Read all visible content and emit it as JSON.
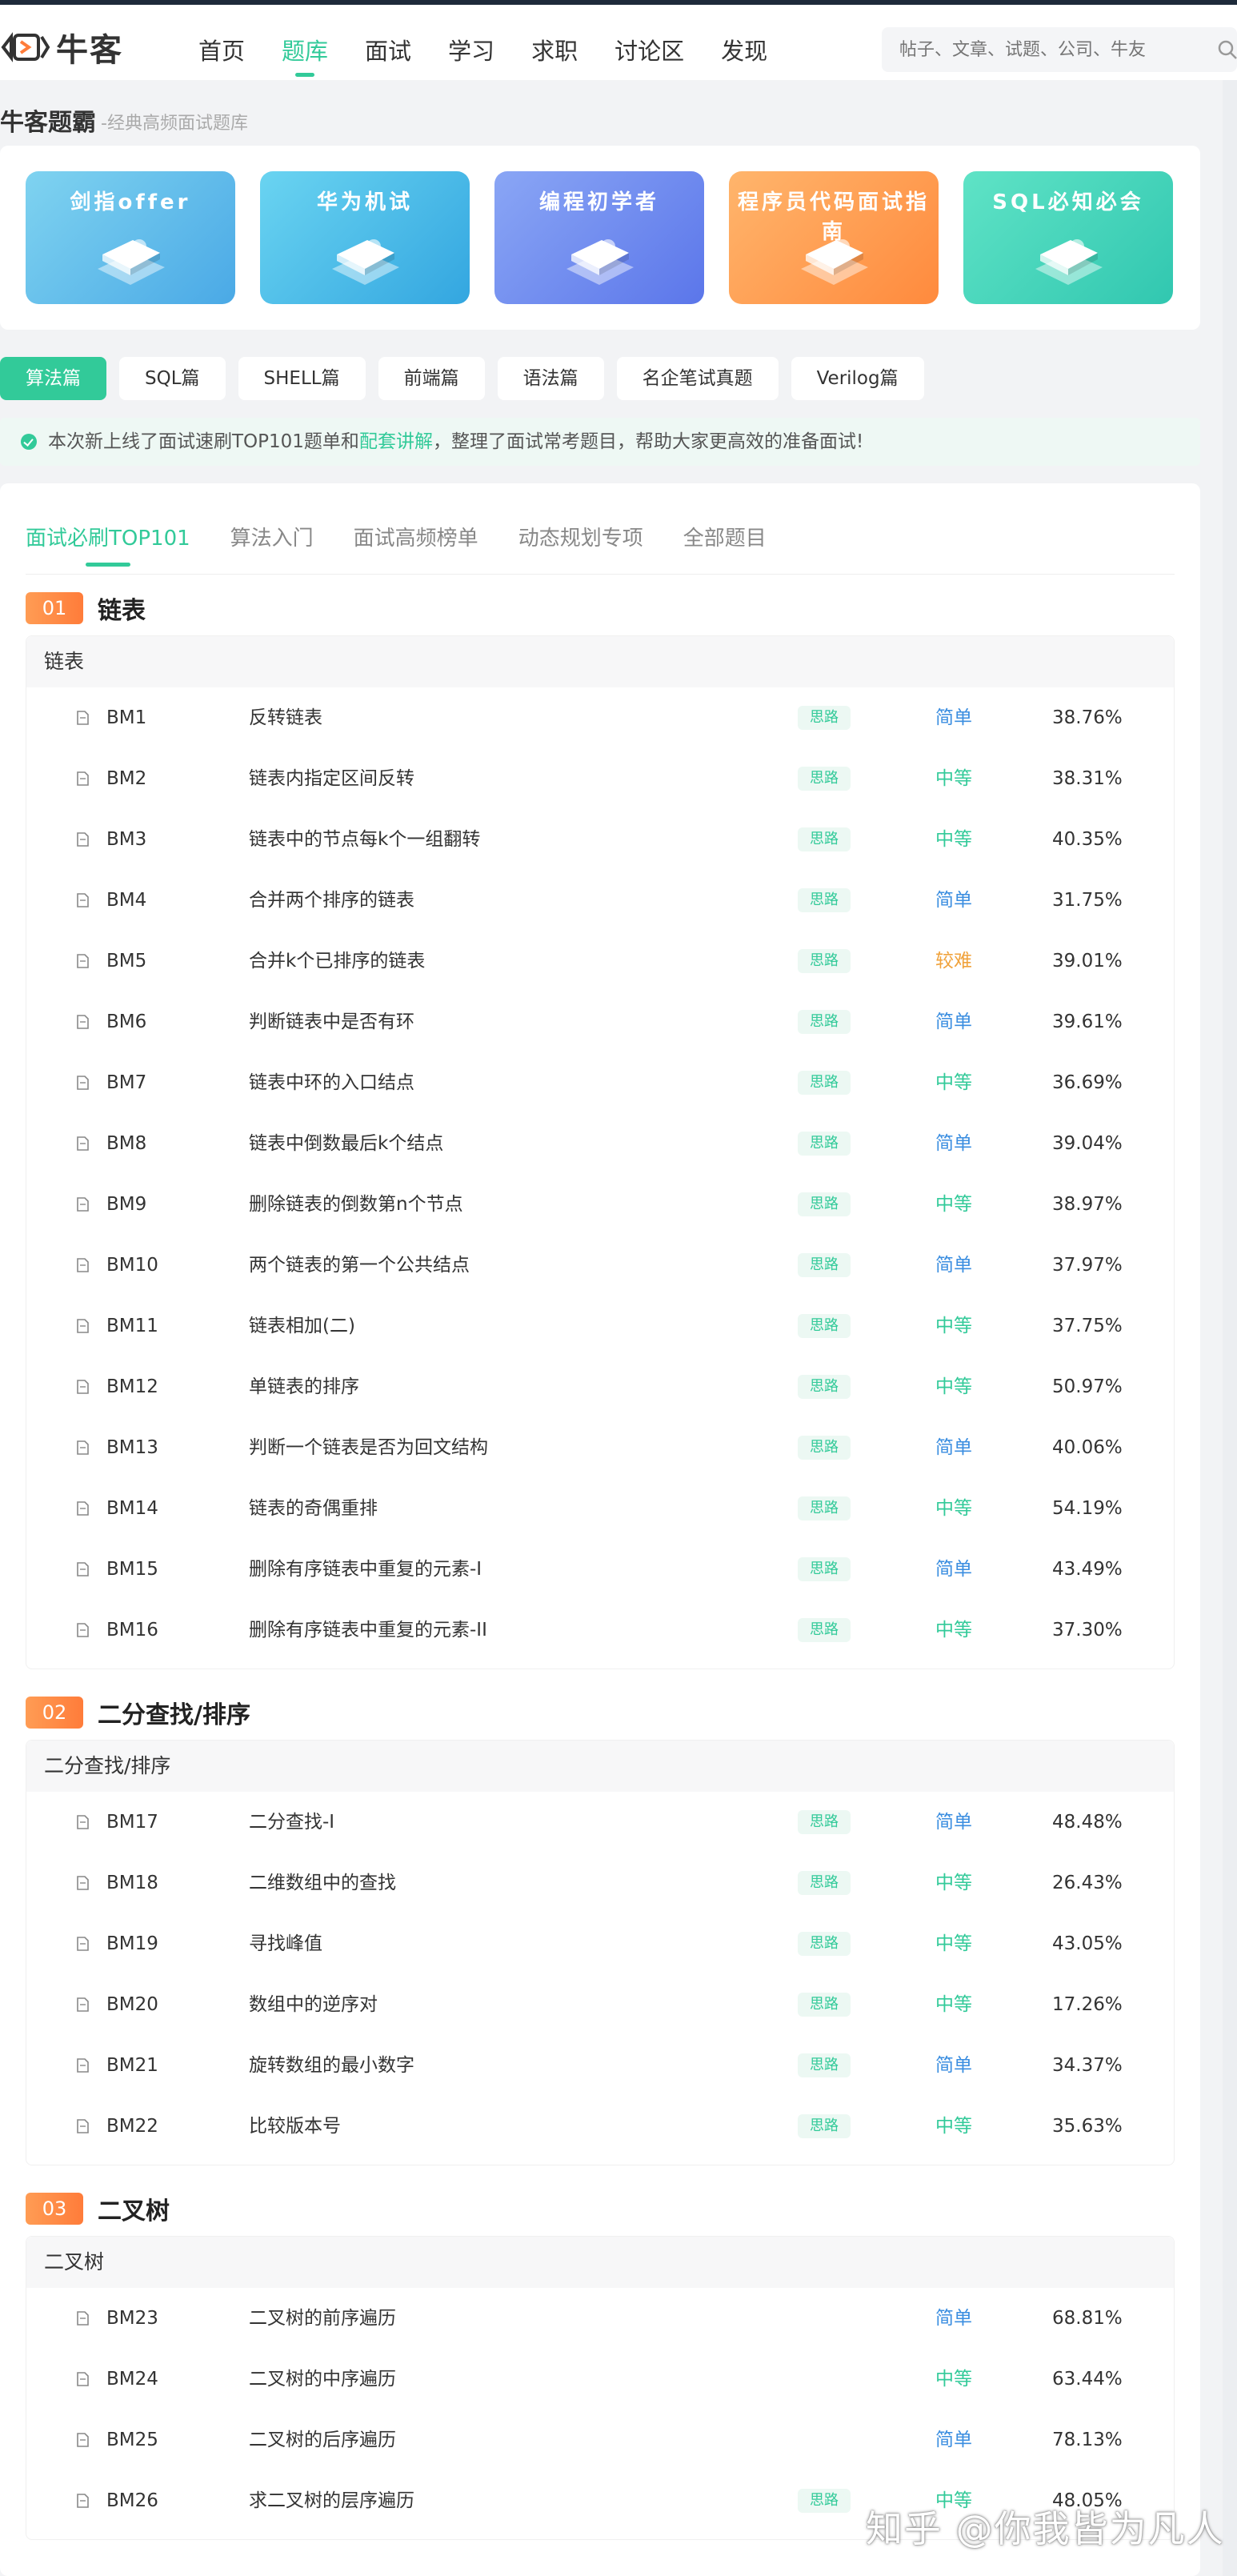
{
  "header": {
    "logo_text": "牛客",
    "nav": [
      "首页",
      "题库",
      "面试",
      "学习",
      "求职",
      "讨论区",
      "发现"
    ],
    "search_placeholder": "帖子、文章、试题、公司、牛友"
  },
  "page": {
    "title": "牛客题霸",
    "subtitle": "-经典高频面试题库"
  },
  "banners": [
    {
      "title": "剑指offer",
      "color_from": "#7fd3f0",
      "color_to": "#4aa9e6"
    },
    {
      "title": "华为机试",
      "color_from": "#6ad4f1",
      "color_to": "#33a6e0"
    },
    {
      "title": "编程初学者",
      "color_from": "#8aa6f5",
      "color_to": "#5b76ea"
    },
    {
      "title": "程序员代码面试指南",
      "color_from": "#ffb56c",
      "color_to": "#ff8a3d"
    },
    {
      "title": "SQL必知必会",
      "color_from": "#5fe3c6",
      "color_to": "#31c7b0"
    }
  ],
  "tags": [
    "算法篇",
    "SQL篇",
    "SHELL篇",
    "前端篇",
    "语法篇",
    "名企笔试真题",
    "Verilog篇"
  ],
  "notice": {
    "before": "本次新上线了面试速刷TOP101题单和",
    "link": "配套讲解",
    "after": "，整理了面试常考题目，帮助大家更高效的准备面试!"
  },
  "tabs": [
    "面试必刷TOP101",
    "算法入门",
    "面试高频榜单",
    "动态规划专项",
    "全部题目"
  ],
  "sections": [
    {
      "num": "01",
      "title": "链表",
      "group": "链表",
      "rows": [
        {
          "id": "BM1",
          "title": "反转链表",
          "badge": "思路",
          "diff": "简单",
          "level": "easy",
          "rate": "38.76%"
        },
        {
          "id": "BM2",
          "title": "链表内指定区间反转",
          "badge": "思路",
          "diff": "中等",
          "level": "mid",
          "rate": "38.31%"
        },
        {
          "id": "BM3",
          "title": "链表中的节点每k个一组翻转",
          "badge": "思路",
          "diff": "中等",
          "level": "mid",
          "rate": "40.35%"
        },
        {
          "id": "BM4",
          "title": "合并两个排序的链表",
          "badge": "思路",
          "diff": "简单",
          "level": "easy",
          "rate": "31.75%"
        },
        {
          "id": "BM5",
          "title": "合并k个已排序的链表",
          "badge": "思路",
          "diff": "较难",
          "level": "hard",
          "rate": "39.01%"
        },
        {
          "id": "BM6",
          "title": "判断链表中是否有环",
          "badge": "思路",
          "diff": "简单",
          "level": "easy",
          "rate": "39.61%"
        },
        {
          "id": "BM7",
          "title": "链表中环的入口结点",
          "badge": "思路",
          "diff": "中等",
          "level": "mid",
          "rate": "36.69%"
        },
        {
          "id": "BM8",
          "title": "链表中倒数最后k个结点",
          "badge": "思路",
          "diff": "简单",
          "level": "easy",
          "rate": "39.04%"
        },
        {
          "id": "BM9",
          "title": "删除链表的倒数第n个节点",
          "badge": "思路",
          "diff": "中等",
          "level": "mid",
          "rate": "38.97%"
        },
        {
          "id": "BM10",
          "title": "两个链表的第一个公共结点",
          "badge": "思路",
          "diff": "简单",
          "level": "easy",
          "rate": "37.97%"
        },
        {
          "id": "BM11",
          "title": "链表相加(二)",
          "badge": "思路",
          "diff": "中等",
          "level": "mid",
          "rate": "37.75%"
        },
        {
          "id": "BM12",
          "title": "单链表的排序",
          "badge": "思路",
          "diff": "中等",
          "level": "mid",
          "rate": "50.97%"
        },
        {
          "id": "BM13",
          "title": "判断一个链表是否为回文结构",
          "badge": "思路",
          "diff": "简单",
          "level": "easy",
          "rate": "40.06%"
        },
        {
          "id": "BM14",
          "title": "链表的奇偶重排",
          "badge": "思路",
          "diff": "中等",
          "level": "mid",
          "rate": "54.19%"
        },
        {
          "id": "BM15",
          "title": "删除有序链表中重复的元素-I",
          "badge": "思路",
          "diff": "简单",
          "level": "easy",
          "rate": "43.49%"
        },
        {
          "id": "BM16",
          "title": "删除有序链表中重复的元素-II",
          "badge": "思路",
          "diff": "中等",
          "level": "mid",
          "rate": "37.30%"
        }
      ]
    },
    {
      "num": "02",
      "title": "二分查找/排序",
      "group": "二分查找/排序",
      "rows": [
        {
          "id": "BM17",
          "title": "二分查找-I",
          "badge": "思路",
          "diff": "简单",
          "level": "easy",
          "rate": "48.48%"
        },
        {
          "id": "BM18",
          "title": "二维数组中的查找",
          "badge": "思路",
          "diff": "中等",
          "level": "mid",
          "rate": "26.43%"
        },
        {
          "id": "BM19",
          "title": "寻找峰值",
          "badge": "思路",
          "diff": "中等",
          "level": "mid",
          "rate": "43.05%"
        },
        {
          "id": "BM20",
          "title": "数组中的逆序对",
          "badge": "思路",
          "diff": "中等",
          "level": "mid",
          "rate": "17.26%"
        },
        {
          "id": "BM21",
          "title": "旋转数组的最小数字",
          "badge": "思路",
          "diff": "简单",
          "level": "easy",
          "rate": "34.37%"
        },
        {
          "id": "BM22",
          "title": "比较版本号",
          "badge": "思路",
          "diff": "中等",
          "level": "mid",
          "rate": "35.63%"
        }
      ]
    },
    {
      "num": "03",
      "title": "二叉树",
      "group": "二叉树",
      "rows": [
        {
          "id": "BM23",
          "title": "二叉树的前序遍历",
          "badge": "",
          "diff": "简单",
          "level": "easy",
          "rate": "68.81%"
        },
        {
          "id": "BM24",
          "title": "二叉树的中序遍历",
          "badge": "",
          "diff": "中等",
          "level": "mid",
          "rate": "63.44%"
        },
        {
          "id": "BM25",
          "title": "二叉树的后序遍历",
          "badge": "",
          "diff": "简单",
          "level": "easy",
          "rate": "78.13%"
        },
        {
          "id": "BM26",
          "title": "求二叉树的层序遍历",
          "badge": "思路",
          "diff": "中等",
          "level": "mid",
          "rate": "48.05%"
        }
      ]
    }
  ],
  "watermark": "知乎 @你我皆为凡人"
}
